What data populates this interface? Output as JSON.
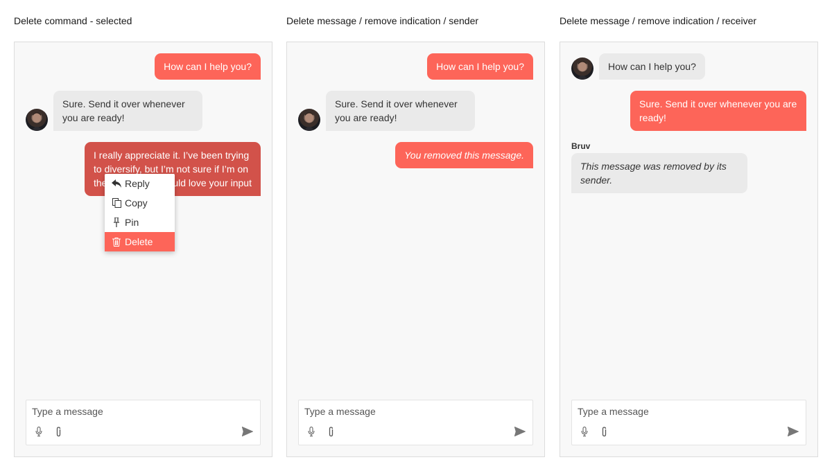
{
  "panels": [
    {
      "title": "Delete command - selected",
      "messages": [
        "How can I help you?",
        "Sure. Send it over whenever you are ready!",
        "I really appreciate it. I've been trying to diversify, but I'm not sure if I'm on the right track. Would love your input"
      ],
      "visible_lines": [
        "I really appreciate it. I’ve been trying",
        "to diversify, but I’m not sure if I’m on",
        "the",
        "uld love your input"
      ],
      "context_menu": [
        "Reply",
        "Copy",
        "Pin",
        "Delete"
      ],
      "selected_menu_item": "Delete"
    },
    {
      "title": "Delete message / remove indication / sender",
      "messages": [
        "How can I help you?",
        "Sure. Send it over whenever you are ready!",
        "You removed this message."
      ]
    },
    {
      "title": "Delete message / remove indication / receiver",
      "messages": [
        "How can I help you?",
        "Sure. Send it over whenever you are ready!",
        "This message was removed by its sender."
      ],
      "sender_name": "Bruv"
    }
  ],
  "composer": {
    "placeholder": "Type a message"
  },
  "colors": {
    "accent": "#fd6559",
    "accent_pressed": "#d2524a",
    "incoming_bubble": "#eaeaea",
    "panel_bg": "#f8f8f8"
  },
  "icons": [
    "reply-icon",
    "copy-icon",
    "pin-icon",
    "trash-icon",
    "microphone-icon",
    "paperclip-icon",
    "send-icon"
  ]
}
